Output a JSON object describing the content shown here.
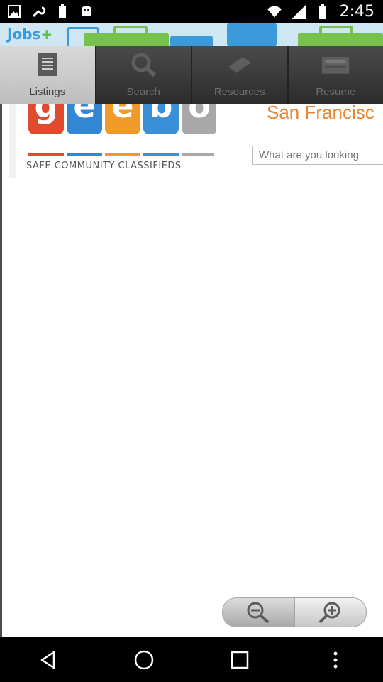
{
  "status_bar": {
    "time": "2:45",
    "left_icons": [
      "image-icon",
      "wrench-icon",
      "battery-icon",
      "android-icon"
    ],
    "right_icons": [
      "wifi-icon",
      "signal-icon",
      "battery-icon"
    ]
  },
  "banner": {
    "logo_text": "Jobs",
    "logo_plus": "+"
  },
  "tabs": [
    {
      "label": "Listings",
      "icon": "document-icon",
      "active": true
    },
    {
      "label": "Search",
      "icon": "magnifier-icon",
      "active": false
    },
    {
      "label": "Resources",
      "icon": "book-icon",
      "active": false
    },
    {
      "label": "Resume",
      "icon": "inbox-icon",
      "active": false
    }
  ],
  "content": {
    "logo_letters": [
      "g",
      "e",
      "e",
      "b",
      "o"
    ],
    "logo_tagline": "SAFE COMMUNITY CLASSIFIEDS",
    "city": "San Francisc",
    "search_placeholder": "What are you looking"
  },
  "zoom": {
    "out_icon": "zoom-out-icon",
    "in_icon": "zoom-in-icon"
  },
  "colors": {
    "accent_orange": "#e78534",
    "banner_blue": "#3b9ad9",
    "banner_green": "#5fc04a"
  }
}
